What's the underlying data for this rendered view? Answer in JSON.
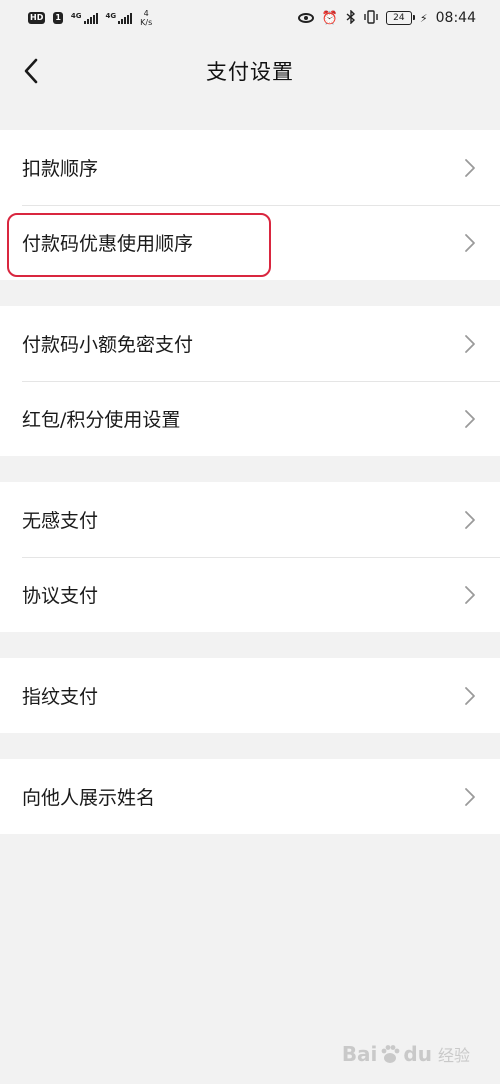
{
  "status_bar": {
    "hd": "HD",
    "sim": "1",
    "net1": "4G",
    "net2": "4G",
    "speed_value": "4",
    "speed_unit": "K/s",
    "battery": "24",
    "time": "08:44",
    "icons": [
      "eye-icon",
      "alarm-icon",
      "bluetooth-icon",
      "vibrate-icon",
      "battery-icon",
      "charging-icon"
    ]
  },
  "nav": {
    "title": "支付设置",
    "back_icon": "chevron-left-icon"
  },
  "groups": [
    {
      "items": [
        {
          "label": "扣款顺序"
        },
        {
          "label": "付款码优惠使用顺序"
        }
      ]
    },
    {
      "items": [
        {
          "label": "付款码小额免密支付"
        },
        {
          "label": "红包/积分使用设置"
        }
      ]
    },
    {
      "items": [
        {
          "label": "无感支付"
        },
        {
          "label": "协议支付"
        }
      ]
    },
    {
      "items": [
        {
          "label": "指纹支付"
        }
      ]
    },
    {
      "items": [
        {
          "label": "向他人展示姓名"
        }
      ]
    }
  ],
  "watermark": {
    "brand_left": "Bai",
    "brand_right": "du",
    "suffix": "经验"
  },
  "colors": {
    "background": "#f2f2f2",
    "card": "#ffffff",
    "highlight_border": "#d9263f",
    "chevron": "#9a9a9a"
  }
}
